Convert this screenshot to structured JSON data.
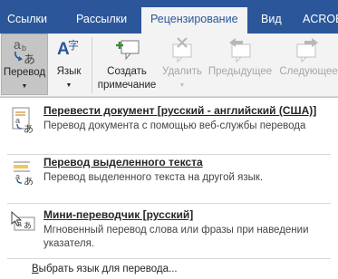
{
  "tabs": [
    {
      "label": "Ссылки"
    },
    {
      "label": "Рассылки"
    },
    {
      "label": "Рецензирование"
    },
    {
      "label": "Вид"
    },
    {
      "label": "ACROE"
    }
  ],
  "ribbon": {
    "translate_label": "Перевод",
    "language_label": "Язык",
    "create_note_line1": "Создать",
    "create_note_line2": "примечание",
    "delete_label": "Удалить",
    "previous_label": "Предыдущее",
    "next_label": "Следующее"
  },
  "menu": {
    "items": [
      {
        "title": "Перевести документ [русский - английский (США)]",
        "desc": "Перевод документа с помощью веб-службы перевода"
      },
      {
        "title": "Перевод выделенного текста",
        "desc": "Перевод выделенного текста на другой язык."
      },
      {
        "title": "Мини-переводчик [русский]",
        "desc": "Мгновенный перевод слова или фразы при наведении указателя."
      }
    ],
    "choose_language_prefix": "В",
    "choose_language_rest": "ыбрать язык для перевода..."
  },
  "colors": {
    "tabbar": "#2b579a",
    "ribbon": "#f3f3f3",
    "accent_green": "#3a8a3a",
    "accent_blue": "#2b579a"
  },
  "icons": {
    "translate": "translate-icon",
    "language": "language-icon",
    "new_comment": "new-comment-icon",
    "delete_comment": "delete-comment-icon",
    "previous_comment": "previous-comment-icon",
    "next_comment": "next-comment-icon"
  }
}
